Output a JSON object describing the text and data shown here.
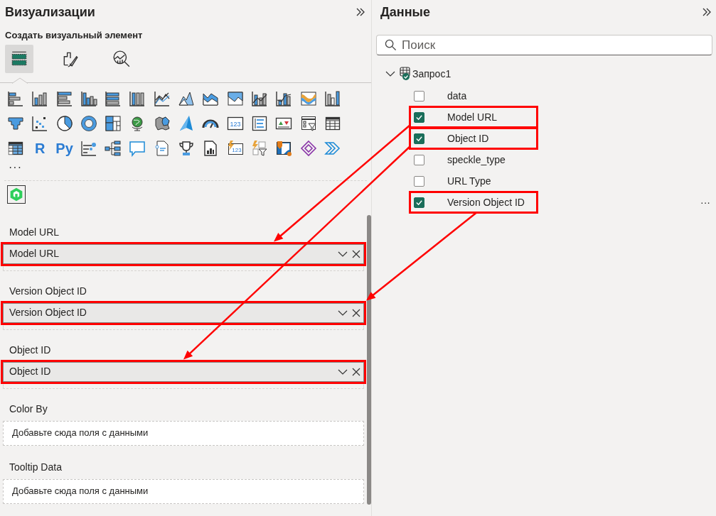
{
  "visualizations": {
    "title": "Визуализации",
    "subtitle": "Создать визуальный элемент",
    "tabs": [
      {
        "selected": true
      },
      {
        "selected": false
      },
      {
        "selected": false
      }
    ],
    "gallery_labels": {
      "card": "123",
      "r": "R",
      "python": "Py",
      "lightning_card": "123"
    },
    "more": "···"
  },
  "wells": [
    {
      "label": "Model URL",
      "field": "Model URL",
      "highlighted": true
    },
    {
      "label": "Version Object ID",
      "field": "Version Object ID",
      "highlighted": true
    },
    {
      "label": "Object ID",
      "field": "Object ID",
      "highlighted": true
    },
    {
      "label": "Color By",
      "hint": "Добавьте сюда поля с данными",
      "highlighted": false
    },
    {
      "label": "Tooltip Data",
      "hint": "Добавьте сюда поля с данными",
      "highlighted": false
    }
  ],
  "data": {
    "title": "Данные",
    "search": {
      "placeholder": "Поиск"
    },
    "tables": [
      {
        "name": "Запрос1",
        "expanded": true,
        "fields": [
          {
            "name": "data",
            "checked": false,
            "highlighted": false
          },
          {
            "name": "Model URL",
            "checked": true,
            "highlighted": true
          },
          {
            "name": "Object ID",
            "checked": true,
            "highlighted": true
          },
          {
            "name": "speckle_type",
            "checked": false,
            "highlighted": false
          },
          {
            "name": "URL Type",
            "checked": false,
            "highlighted": false
          },
          {
            "name": "Version Object ID",
            "checked": true,
            "highlighted": true,
            "more": "···"
          }
        ]
      }
    ]
  },
  "annotations": {
    "arrows_shown": true
  }
}
